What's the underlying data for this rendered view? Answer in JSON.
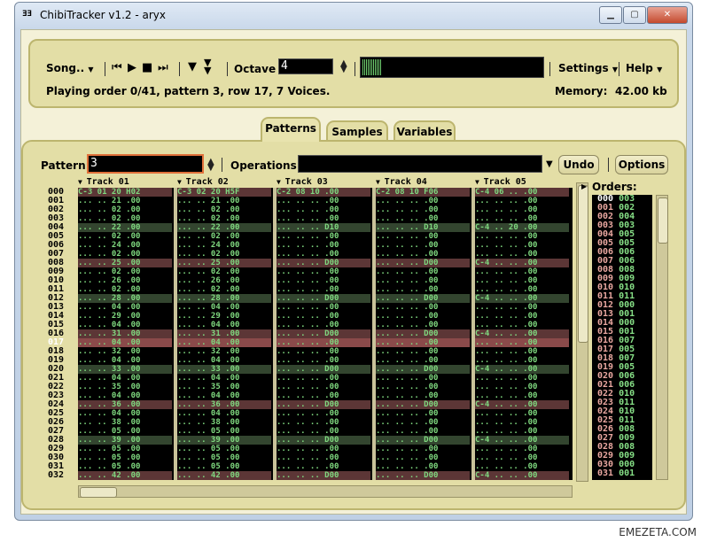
{
  "window": {
    "title": "ChibiTracker v1.2 - aryx",
    "app_icon": "ƎƎ"
  },
  "toolbar": {
    "song_label": "Song..",
    "octave_label": "Octave",
    "octave_value": "4",
    "settings_label": "Settings",
    "help_label": "Help",
    "status": "Playing order 0/41, pattern 3, row 17, 7 Voices.",
    "memory_label": "Memory:",
    "memory_value": "42.00 kb"
  },
  "tabs": {
    "patterns": "Patterns",
    "samples": "Samples",
    "variables": "Variables"
  },
  "pattern_bar": {
    "pattern_label": "Pattern:",
    "pattern_value": "3",
    "operations_label": "Operations:",
    "undo_label": "Undo",
    "options_label": "Options"
  },
  "tracks": [
    {
      "name": "Track 01"
    },
    {
      "name": "Track 02"
    },
    {
      "name": "Track 03"
    },
    {
      "name": "Track 04"
    },
    {
      "name": "Track 05"
    }
  ],
  "current_row": 17,
  "orders_label": "Orders:",
  "orders_patterns": [
    "003",
    "002",
    "004",
    "003",
    "005",
    "005",
    "006",
    "006",
    "008",
    "009",
    "010",
    "011",
    "000",
    "001",
    "000",
    "001",
    "007",
    "005",
    "007",
    "005",
    "006",
    "006",
    "010",
    "011",
    "010",
    "011",
    "008",
    "009",
    "008",
    "009",
    "000",
    "001"
  ],
  "watermark": "EMEZETA.COM"
}
